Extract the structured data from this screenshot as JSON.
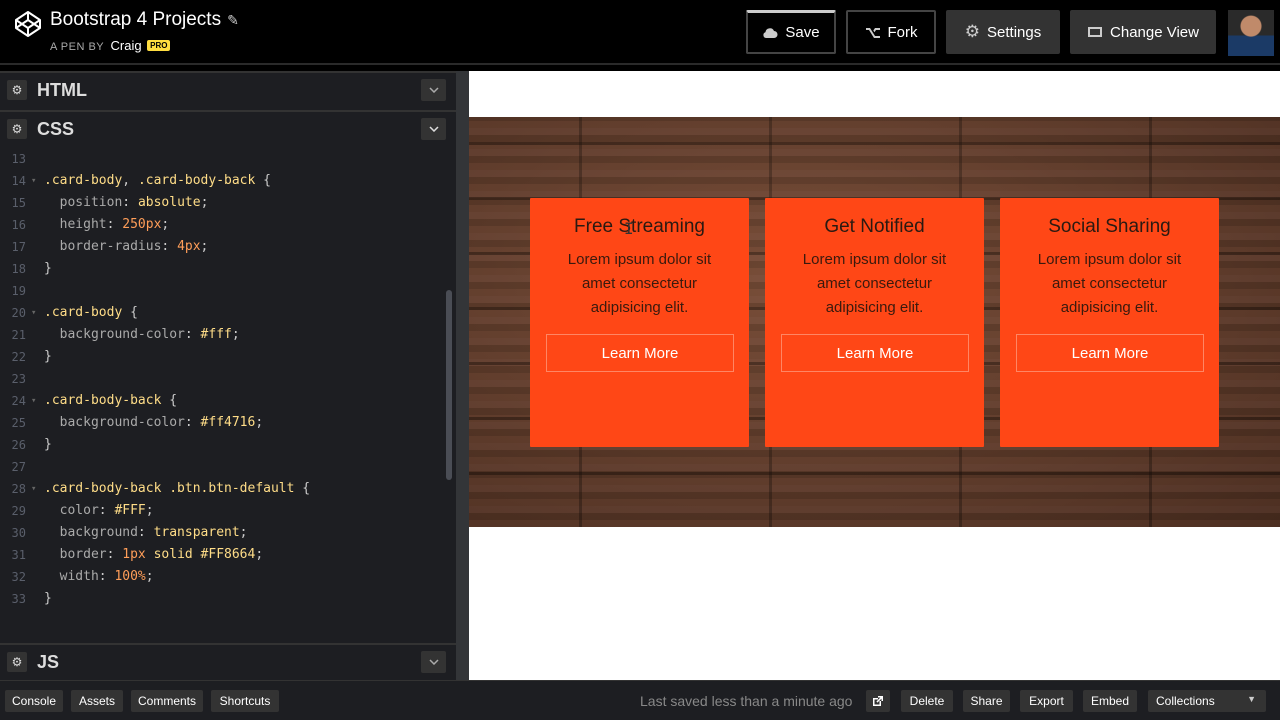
{
  "header": {
    "title": "Bootstrap 4 Projects",
    "pen_by": "A PEN BY",
    "author": "Craig",
    "pro_badge": "PRO",
    "buttons": {
      "save": "Save",
      "fork": "Fork",
      "settings": "Settings",
      "change_view": "Change View"
    }
  },
  "panels": {
    "html": "HTML",
    "css": "CSS",
    "js": "JS"
  },
  "css_code": [
    {
      "n": "13",
      "parts": []
    },
    {
      "n": "14",
      "fold": true,
      "parts": [
        [
          "sel",
          ".card-body"
        ],
        [
          "pun",
          ", "
        ],
        [
          "sel",
          ".card-body-back"
        ],
        [
          "pun",
          " {"
        ]
      ]
    },
    {
      "n": "15",
      "parts": [
        [
          "prop",
          "  position"
        ],
        [
          "pun",
          ": "
        ],
        [
          "val-k",
          "absolute"
        ],
        [
          "pun",
          ";"
        ]
      ]
    },
    {
      "n": "16",
      "parts": [
        [
          "prop",
          "  height"
        ],
        [
          "pun",
          ": "
        ],
        [
          "val-n",
          "250px"
        ],
        [
          "pun",
          ";"
        ]
      ]
    },
    {
      "n": "17",
      "parts": [
        [
          "prop",
          "  border-radius"
        ],
        [
          "pun",
          ": "
        ],
        [
          "val-n",
          "4px"
        ],
        [
          "pun",
          ";"
        ]
      ]
    },
    {
      "n": "18",
      "parts": [
        [
          "pun",
          "}"
        ]
      ]
    },
    {
      "n": "19",
      "parts": []
    },
    {
      "n": "20",
      "fold": true,
      "parts": [
        [
          "sel",
          ".card-body"
        ],
        [
          "pun",
          " {"
        ]
      ]
    },
    {
      "n": "21",
      "parts": [
        [
          "prop",
          "  background-color"
        ],
        [
          "pun",
          ": "
        ],
        [
          "val-k",
          "#fff"
        ],
        [
          "pun",
          ";"
        ]
      ]
    },
    {
      "n": "22",
      "parts": [
        [
          "pun",
          "}"
        ]
      ]
    },
    {
      "n": "23",
      "parts": []
    },
    {
      "n": "24",
      "fold": true,
      "parts": [
        [
          "sel",
          ".card-body-back"
        ],
        [
          "pun",
          " {"
        ]
      ]
    },
    {
      "n": "25",
      "parts": [
        [
          "prop",
          "  background-color"
        ],
        [
          "pun",
          ": "
        ],
        [
          "val-k",
          "#ff4716"
        ],
        [
          "pun",
          ";"
        ]
      ]
    },
    {
      "n": "26",
      "parts": [
        [
          "pun",
          "}"
        ]
      ]
    },
    {
      "n": "27",
      "parts": []
    },
    {
      "n": "28",
      "fold": true,
      "parts": [
        [
          "sel",
          ".card-body-back .btn.btn-default"
        ],
        [
          "pun",
          " {"
        ]
      ]
    },
    {
      "n": "29",
      "parts": [
        [
          "prop",
          "  color"
        ],
        [
          "pun",
          ": "
        ],
        [
          "val-k",
          "#FFF"
        ],
        [
          "pun",
          ";"
        ]
      ]
    },
    {
      "n": "30",
      "parts": [
        [
          "prop",
          "  background"
        ],
        [
          "pun",
          ": "
        ],
        [
          "val-k",
          "transparent"
        ],
        [
          "pun",
          ";"
        ]
      ]
    },
    {
      "n": "31",
      "parts": [
        [
          "prop",
          "  border"
        ],
        [
          "pun",
          ": "
        ],
        [
          "val-n",
          "1px"
        ],
        [
          "val-k",
          " solid #FF8664"
        ],
        [
          "pun",
          ";"
        ]
      ]
    },
    {
      "n": "32",
      "parts": [
        [
          "prop",
          "  width"
        ],
        [
          "pun",
          ": "
        ],
        [
          "val-n",
          "100%"
        ],
        [
          "pun",
          ";"
        ]
      ]
    },
    {
      "n": "33",
      "parts": [
        [
          "pun",
          "}"
        ]
      ]
    }
  ],
  "cards": [
    {
      "title": "Free Streaming",
      "text": "Lorem ipsum dolor sit amet consectetur adipisicing elit.",
      "button": "Learn More"
    },
    {
      "title": "Get Notified",
      "text": "Lorem ipsum dolor sit amet consectetur adipisicing elit.",
      "button": "Learn More"
    },
    {
      "title": "Social Sharing",
      "text": "Lorem ipsum dolor sit amet consectetur adipisicing elit.",
      "button": "Learn More"
    }
  ],
  "footer": {
    "console": "Console",
    "assets": "Assets",
    "comments": "Comments",
    "shortcuts": "Shortcuts",
    "saved_status": "Last saved less than a minute ago",
    "delete": "Delete",
    "share": "Share",
    "export": "Export",
    "embed": "Embed",
    "collections": "Collections"
  },
  "colors": {
    "card_accent": "#ff4716",
    "button_border": "#ff8664",
    "pro_badge": "#ffdd40"
  },
  "icons": {
    "logo": "codepen-logo-icon",
    "pencil": "pencil-icon",
    "save": "cloud-icon",
    "fork": "fork-icon",
    "settings": "gear-icon",
    "change_view": "change-view-icon",
    "panel_settings": "gear-icon",
    "panel_collapse": "chevron-down-icon",
    "external_view": "external-link-icon",
    "collections": "caret-down-icon"
  }
}
